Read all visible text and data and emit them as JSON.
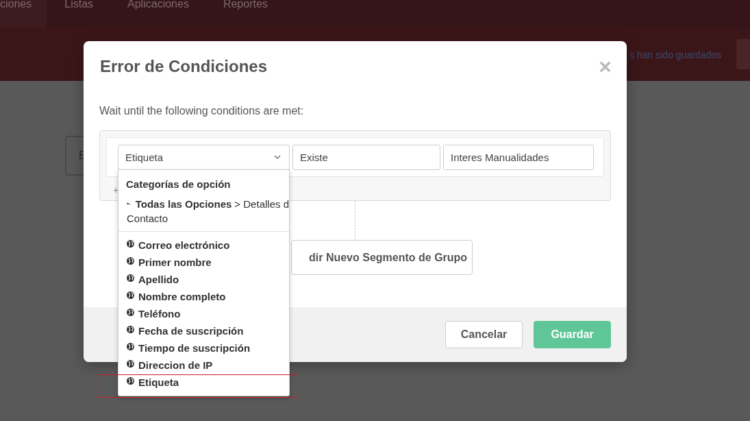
{
  "nav": {
    "tabs": [
      {
        "label": "ciones",
        "selected": true
      },
      {
        "label": "Listas",
        "selected": false
      },
      {
        "label": "Aplicaciones",
        "selected": false
      },
      {
        "label": "Reportes",
        "selected": false
      }
    ]
  },
  "banner": {
    "message": "s han sido guardados"
  },
  "background_card": {
    "text": "E"
  },
  "dialog": {
    "title": "Error de Condiciones",
    "close": "×",
    "instruction": "Wait until the following conditions are met:",
    "condition": {
      "field": "Etiqueta",
      "operator": "Existe",
      "value": "Interes Manualidades"
    },
    "add_condition": "+",
    "add_group_button": "dir Nuevo Segmento de Grupo",
    "dropdown": {
      "heading": "Categorías de opción",
      "breadcrumb_link": "Todas las Opciones",
      "breadcrumb_rest": "> Detalles d",
      "breadcrumb_line2": "Contacto",
      "items": [
        {
          "label": "Correo electrónico",
          "highlighted": false
        },
        {
          "label": "Primer nombre",
          "highlighted": false
        },
        {
          "label": "Apellido",
          "highlighted": false
        },
        {
          "label": "Nombre completo",
          "highlighted": false
        },
        {
          "label": "Teléfono",
          "highlighted": false
        },
        {
          "label": "Fecha de suscripción",
          "highlighted": false
        },
        {
          "label": "Tiempo de suscripción",
          "highlighted": false
        },
        {
          "label": "Direccion de IP",
          "highlighted": false
        },
        {
          "label": "Etiqueta",
          "highlighted": true
        }
      ]
    },
    "buttons": [
      {
        "label": "Cancelar",
        "kind": "secondary"
      },
      {
        "label": "Guardar",
        "kind": "primary"
      }
    ]
  }
}
